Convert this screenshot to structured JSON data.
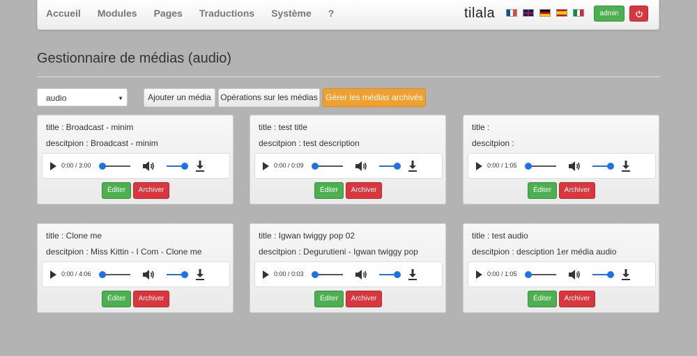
{
  "nav": {
    "items": [
      "Accueil",
      "Modules",
      "Pages",
      "Traductions",
      "Système",
      "?"
    ],
    "brand": "tilala",
    "flags": [
      "fr",
      "uk",
      "de",
      "es",
      "it"
    ],
    "admin_label": "admin",
    "power_icon": "power-icon"
  },
  "header": {
    "title": "Gestionnaire de médias (audio)"
  },
  "toolbar": {
    "select_value": "audio",
    "add_label": "Ajouter un média",
    "ops_label": "Opérations sur les médias",
    "archived_label": "Gérer les médias archivés"
  },
  "colors": {
    "edit": "#4caf50",
    "archive": "#d9363e",
    "accent": "#f0a030",
    "progress": "#1a73e8"
  },
  "cards": [
    {
      "title": "title : Broadcast - minim",
      "desc": "descitpion : Broadcast - minim",
      "time": "0:00 / 3:00",
      "progress": 0.0,
      "edit": "Éditer",
      "archive": "Archiver"
    },
    {
      "title": "title : test title",
      "desc": "descitpion : test description",
      "time": "0:00 / 0:09",
      "progress": 0.0,
      "edit": "Éditer",
      "archive": "Archiver"
    },
    {
      "title": "title : ",
      "desc": "descitpion : ",
      "time": "0:00 / 1:05",
      "progress": 0.0,
      "edit": "Éditer",
      "archive": "Archiver"
    },
    {
      "title": "title : Clone me",
      "desc": "descitpion : Miss Kittin - I Com - Clone me",
      "time": "0:00 / 4:06",
      "progress": 0.0,
      "edit": "Éditer",
      "archive": "Archiver"
    },
    {
      "title": "title : Igwan twiggy pop 02",
      "desc": "descitpion : Degurutieni - Igwan twiggy pop",
      "time": "0:00 / 0:03",
      "progress": 0.0,
      "edit": "Éditer",
      "archive": "Archiver"
    },
    {
      "title": "title : test audio",
      "desc": "descitpion : desciption 1er média audio",
      "time": "0:00 / 1:05",
      "progress": 0.0,
      "edit": "Éditer",
      "archive": "Archiver"
    }
  ]
}
